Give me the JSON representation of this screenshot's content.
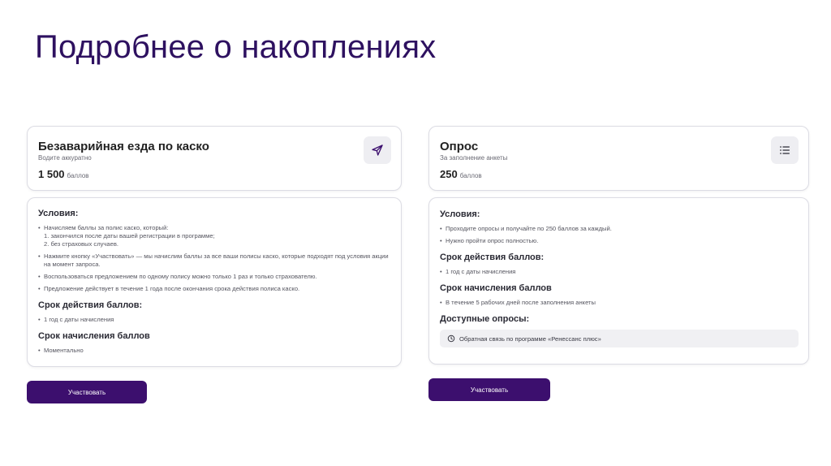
{
  "page": {
    "title": "Подробнее о накоплениях"
  },
  "left": {
    "title": "Безаварийная езда по каско",
    "subtitle": "Водите аккуратно",
    "points": "1 500",
    "points_unit": "баллов",
    "icon": "send-icon",
    "conditions_title": "Условия:",
    "conditions": [
      {
        "text": "Начисляем баллы за полис каско, который:",
        "subs": [
          "1. закончился после даты вашей регистрации в программе;",
          "2. без страховых случаев."
        ]
      },
      {
        "text": "Нажмите кнопку «Участвовать» — мы начислим баллы за все ваши полисы каско, которые подходят под условия акции на момент запроса.",
        "subs": []
      },
      {
        "text": "Воспользоваться предложением по одному полису можно только 1 раз и только страхователю.",
        "subs": []
      },
      {
        "text": "Предложение действует в течение 1 года после окончания срока действия полиса каско.",
        "subs": []
      }
    ],
    "validity_title": "Срок действия баллов:",
    "validity": "1 год с даты начисления",
    "accrual_title": "Срок начисления баллов",
    "accrual": "Моментально",
    "button": "Участвовать"
  },
  "right": {
    "title": "Опрос",
    "subtitle": "За заполнение анкеты",
    "points": "250",
    "points_unit": "баллов",
    "icon": "list-icon",
    "conditions_title": "Условия:",
    "conditions": [
      "Проходите опросы и получайте по 250 баллов за каждый.",
      "Нужно пройти опрос полностью."
    ],
    "validity_title": "Срок действия баллов:",
    "validity": "1 год с даты начисления",
    "accrual_title": "Срок начисления баллов",
    "accrual": "В течение 5 рабочих дней после заполнения анкеты",
    "available_title": "Доступные опросы:",
    "survey": "Обратная связь по программе «Ренессанс плюс»",
    "button": "Участвовать"
  },
  "colors": {
    "accent": "#3c0f6e",
    "title": "#2e1160",
    "border": "#dcdce4"
  }
}
